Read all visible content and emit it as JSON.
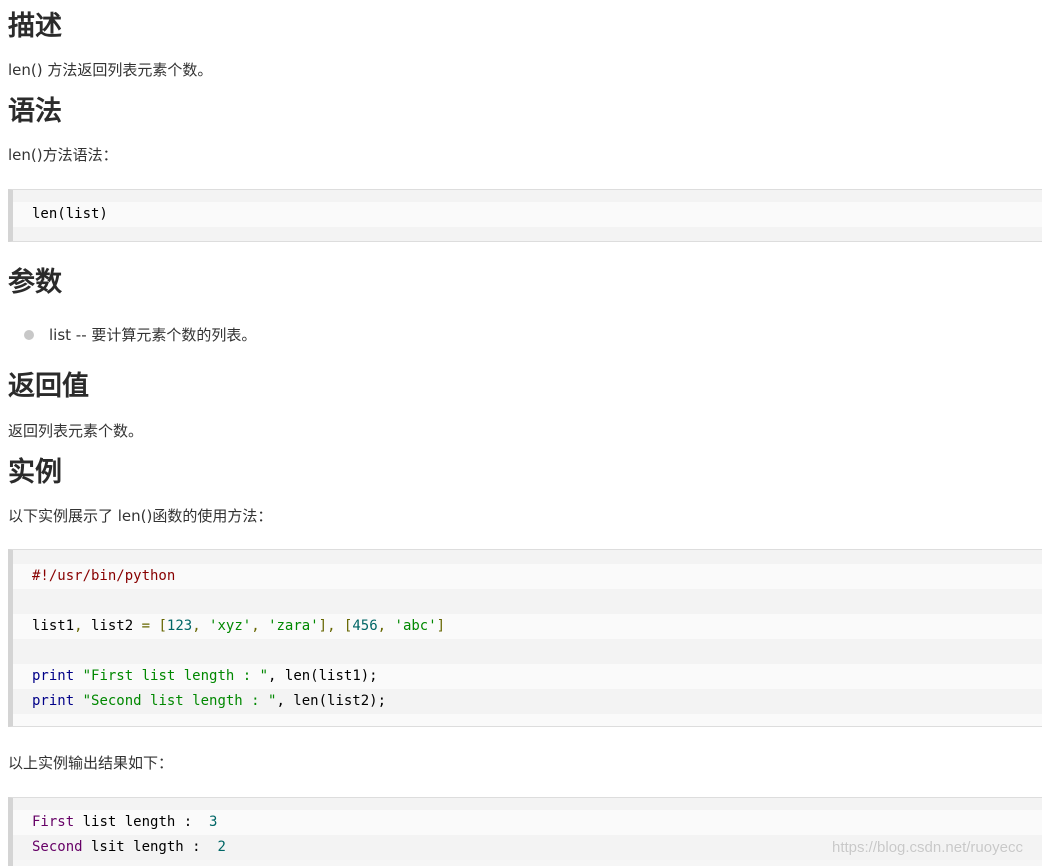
{
  "sections": {
    "description": {
      "heading": "描述",
      "text": "len() 方法返回列表元素个数。"
    },
    "syntax": {
      "heading": "语法",
      "text": "len()方法语法：",
      "code": {
        "line1": "len(list)"
      }
    },
    "parameters": {
      "heading": "参数",
      "items": [
        {
          "text": "list -- 要计算元素个数的列表。"
        }
      ]
    },
    "return_value": {
      "heading": "返回值",
      "text": "返回列表元素个数。"
    },
    "example": {
      "heading": "实例",
      "text": "以下实例展示了 len()函数的使用方法：",
      "code": {
        "line1_comment": "#!/usr/bin/python",
        "line3_a": "list1",
        "line3_b": ", ",
        "line3_c": "list2 ",
        "line3_d": "= [",
        "line3_e": "123",
        "line3_f": ", ",
        "line3_g": "'xyz'",
        "line3_h": ", ",
        "line3_i": "'zara'",
        "line3_j": "], [",
        "line3_k": "456",
        "line3_l": ", ",
        "line3_m": "'abc'",
        "line3_n": "]",
        "line5_kw": "print",
        "line5_str": " \"First list length : \"",
        "line5_rest": ", len(list1);",
        "line6_kw": "print",
        "line6_str": " \"Second list length : \"",
        "line6_rest": ", len(list2);"
      },
      "output_intro": "以上实例输出结果如下：",
      "output": {
        "line1_a": "First",
        "line1_b": " list length :  ",
        "line1_c": "3",
        "line2_a": "Second",
        "line2_b": " lsit length :  ",
        "line2_c": "2"
      }
    }
  },
  "watermark": "https://blog.csdn.net/ruoyecc",
  "colors": {
    "heading": "#2b2b2b",
    "text": "#333333",
    "code_bg": "#f6f6f6",
    "code_border_left": "#d4d4d4",
    "keyword": "#000088",
    "string": "#008800",
    "number": "#006666",
    "comment": "#880000",
    "bullet": "#c8c8c8"
  },
  "icons": {
    "bullet": "bullet-dot-icon"
  }
}
